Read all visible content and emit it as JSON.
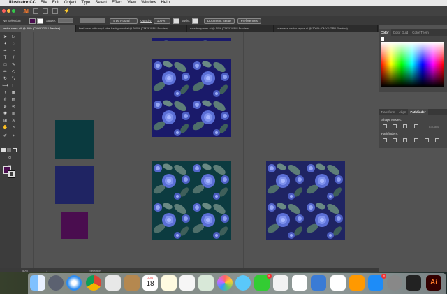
{
  "menubar": {
    "app_name": "Illustrator CC",
    "items": [
      "File",
      "Edit",
      "Object",
      "Type",
      "Select",
      "Effect",
      "View",
      "Window",
      "Help"
    ]
  },
  "appbar": {
    "logo": "Ai"
  },
  "control_bar": {
    "selection_label": "No Selection",
    "stroke_label": "Stroke:",
    "brush_value": "5 pt. Round",
    "opacity_label": "Opacity:",
    "opacity_value": "100%",
    "style_label": "Style:",
    "document_setup": "Document Setup",
    "preferences": "Preferences"
  },
  "tabs": [
    "vector roses.ai* @ 50% (CMYK/GPU Preview)",
    "final roses with royal blue background.ai @ 300% (CMYK/GPU Preview)",
    "rose templates.ai @ 50% (CMYK/GPU Preview)",
    "seamless vector layers.ai @ 300% (CMYK/GPU Preview)"
  ],
  "color_panel": {
    "tabs": [
      "Color",
      "Color Guid",
      "Color Them"
    ]
  },
  "pathfinder_panel": {
    "tabs": [
      "Transform",
      "Align",
      "Pathfinder"
    ],
    "shape_modes_label": "Shape Modes:",
    "expand_label": "Expand",
    "pathfinders_label": "Pathfinders:"
  },
  "status_bar": {
    "zoom": "50%",
    "artboard": "1",
    "tool": "Selection"
  },
  "dock": {
    "calendar_month": "JUN",
    "calendar_day": "18",
    "badges": [
      "9",
      "3"
    ]
  },
  "colors": {
    "teal_swatch": "#0a3a3f",
    "navy_swatch": "#1f2463",
    "purple_swatch": "#4a0d4f",
    "fill_color": "#4a0d4f"
  },
  "icons": [
    "selection-tool-icon",
    "direct-selection-tool-icon",
    "pen-tool-icon",
    "type-tool-icon",
    "line-tool-icon",
    "rectangle-tool-icon",
    "paintbrush-icon",
    "pencil-icon",
    "eraser-icon",
    "rotate-icon",
    "scale-icon",
    "width-icon",
    "free-transform-icon",
    "shape-builder-icon",
    "perspective-icon",
    "mesh-icon",
    "gradient-icon",
    "eyedropper-icon",
    "blend-icon",
    "symbol-sprayer-icon",
    "graph-icon",
    "artboard-icon",
    "slice-icon",
    "hand-icon",
    "zoom-icon"
  ]
}
